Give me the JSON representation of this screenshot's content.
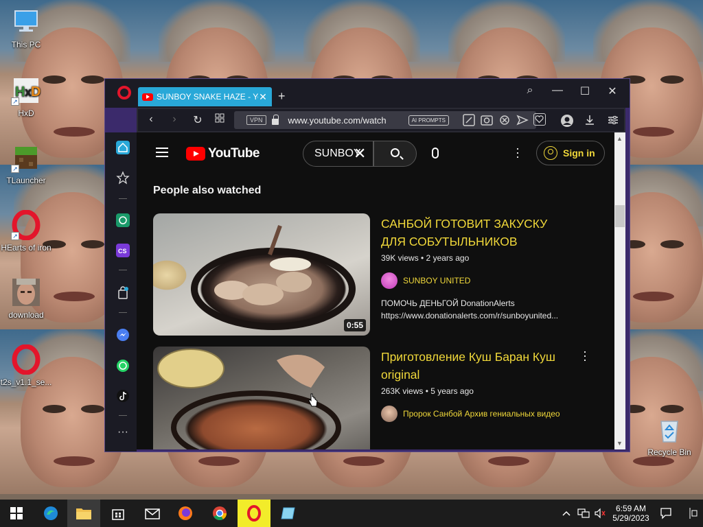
{
  "desktop": {
    "icons": [
      {
        "label": "This PC"
      },
      {
        "label": "HxD"
      },
      {
        "label": "TLauncher"
      },
      {
        "label": "HEarts of iron"
      },
      {
        "label": "download"
      },
      {
        "label": "t2s_v1.1_se..."
      },
      {
        "label": "Recycle Bin"
      }
    ]
  },
  "browser": {
    "tab_title": "SUNBOY SNAKE HAZE - Yo",
    "tab_close": "✕",
    "new_tab": "+",
    "vpn_label": "VPN",
    "url": "www.youtube.com/watch",
    "ai_prompts_label": "AI PROMPTS",
    "window_controls": {
      "search": "⌕",
      "minimize": "—",
      "maximize": "☐",
      "close": "✕"
    }
  },
  "youtube": {
    "logo_text": "YouTube",
    "search_value": "SUNBOY",
    "sign_in_label": "Sign in",
    "section_title": "People also watched",
    "videos": [
      {
        "title": "САНБОЙ ГОТОВИТ ЗАКУСКУ ДЛЯ СОБУТЫЛЬНИКОВ",
        "meta": "39K views • 2 years ago",
        "channel": "SUNBOY UNITED",
        "duration": "0:55",
        "desc_line1": "ПОМОЧЬ ДЕНЬГОЙ DonationAlerts",
        "desc_line2": "https://www.donationalerts.com/r/sunboyunited..."
      },
      {
        "title": "Приготовление Куш Баран Куш original",
        "meta": "263K views • 5 years ago",
        "channel": "Пророк Санбой Архив гениальных видео"
      }
    ]
  },
  "taskbar": {
    "time": "6:59 AM",
    "date": "5/29/2023"
  },
  "colors": {
    "accent_yellow": "#f0d83a",
    "tab_blue": "#29a8d8",
    "window_border": "#3b2a6b",
    "youtube_red": "#ff0000"
  }
}
